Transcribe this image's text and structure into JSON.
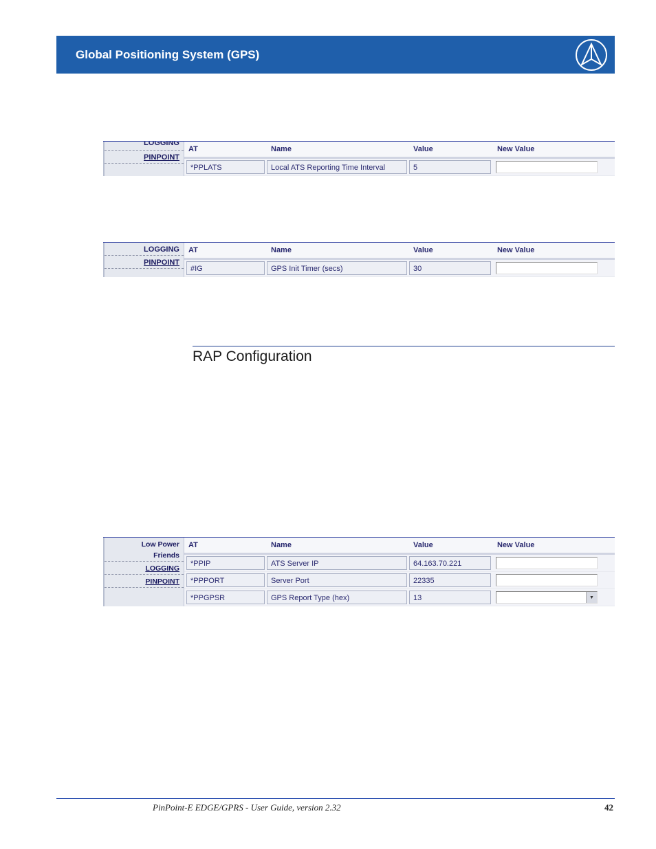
{
  "header": {
    "title": "Global Positioning System (GPS)"
  },
  "table_headers": {
    "at": "AT",
    "name": "Name",
    "value": "Value",
    "new_value": "New Value"
  },
  "panel1": {
    "nav": {
      "top": "LOGGING",
      "active": "PINPOINT"
    },
    "row": {
      "at": "*PPLATS",
      "name": "Local ATS Reporting Time Interval (secs)",
      "value": "5"
    }
  },
  "panel2": {
    "nav": {
      "top": "LOGGING",
      "active": "PINPOINT"
    },
    "row": {
      "at": "#IG",
      "name": "GPS Init Timer (secs)",
      "value": "30"
    }
  },
  "section": {
    "heading": "RAP Configuration"
  },
  "panel3": {
    "nav": {
      "item1": "Low Power",
      "item2": "Friends",
      "item3": "LOGGING",
      "item4": "PINPOINT"
    },
    "rows": [
      {
        "at": "*PPIP",
        "name": "ATS Server IP",
        "value": "64.163.70.221",
        "type": "text"
      },
      {
        "at": "*PPPORT",
        "name": "Server Port",
        "value": "22335",
        "type": "text"
      },
      {
        "at": "*PPGPSR",
        "name": "GPS Report Type (hex)",
        "value": "13",
        "type": "select"
      }
    ]
  },
  "footer": {
    "doc_title": "PinPoint-E EDGE/GPRS - User Guide, version 2.32",
    "page": "42"
  }
}
